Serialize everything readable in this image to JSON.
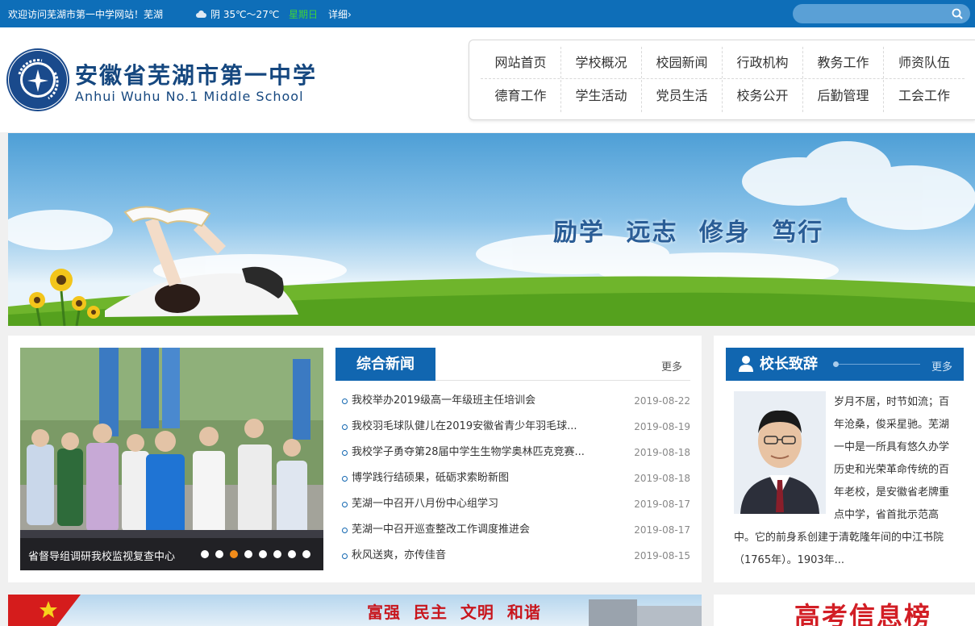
{
  "topbar": {
    "welcome": "欢迎访问芜湖市第一中学网站！芜湖",
    "weather": "阴  35℃～27℃",
    "weekday": "星期日",
    "detail": "详细›",
    "search_placeholder": ""
  },
  "header": {
    "school_cn": "安徽省芜湖市第一中学",
    "school_en": "Anhui Wuhu No.1 Middle School"
  },
  "nav": {
    "row1": [
      "网站首页",
      "学校概况",
      "校园新闻",
      "行政机构",
      "教务工作",
      "师资队伍"
    ],
    "row2": [
      "德育工作",
      "学生活动",
      "党员生活",
      "校务公开",
      "后勤管理",
      "工会工作"
    ]
  },
  "banner": {
    "motto": "励学 远志 修身 笃行"
  },
  "slider": {
    "caption": "省督导组调研我校监视复查中心",
    "dot_count": 8,
    "active_dot": 3
  },
  "news": {
    "title": "综合新闻",
    "more": "更多",
    "items": [
      {
        "title": "我校举办2019级高一年级班主任培训会",
        "date": "2019-08-22"
      },
      {
        "title": "我校羽毛球队健儿在2019安徽省青少年羽毛球...",
        "date": "2019-08-19"
      },
      {
        "title": "我校学子勇夺第28届中学生生物学奥林匹克竞赛...",
        "date": "2019-08-18"
      },
      {
        "title": "博学践行结硕果，砥砺求索盼新图",
        "date": "2019-08-18"
      },
      {
        "title": "芜湖一中召开八月份中心组学习",
        "date": "2019-08-17"
      },
      {
        "title": "芜湖一中召开巡查整改工作调度推进会",
        "date": "2019-08-17"
      },
      {
        "title": "秋风送爽，亦传佳音",
        "date": "2019-08-15"
      }
    ]
  },
  "principal": {
    "title": "校长致辞",
    "more": "更多",
    "text": "岁月不居，时节如流；百年沧桑，俊采星驰。芜湖一中是一所具有悠久办学历史和光荣革命传统的百年老校，是安徽省老牌重点中学，省首批示范高中。它的前身系创建于清乾隆年间的中江书院（1765年）。1903年..."
  },
  "bottom": {
    "slogan": "富强  民主  文明  和谐",
    "gaokao": "高考信息榜"
  },
  "colors": {
    "topbar": "#0e6eb8",
    "brand_blue": "#1166b0",
    "school_name": "#15477f",
    "weekday_green": "#3fd13a",
    "active_dot": "#f28c1a"
  }
}
